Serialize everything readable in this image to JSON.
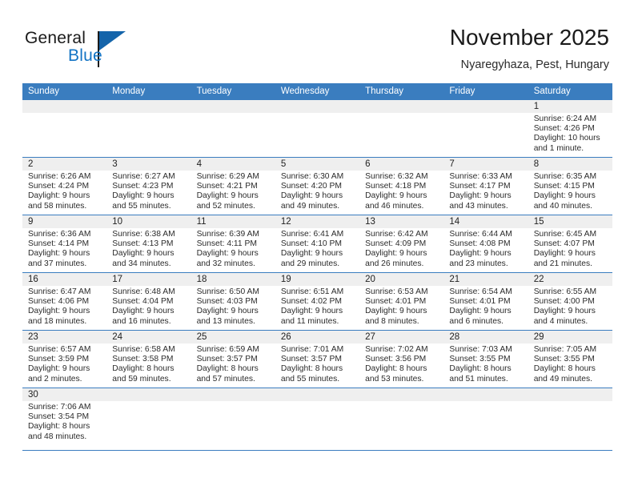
{
  "brand": {
    "word_one": "General",
    "word_two": "Blue",
    "logo_icon": "triangle-flag-icon",
    "accent_color": "#1273c4",
    "triangle_color": "#1464aa"
  },
  "header": {
    "title": "November 2025",
    "subtitle": "Nyaregyhaza, Pest, Hungary"
  },
  "theme": {
    "header_row_bg": "#3a7dbf",
    "day_band_bg": "#efefef",
    "row_separator": "#3a7dbf",
    "text": "#2b2b2b"
  },
  "calendar": {
    "weekday_headers": [
      "Sunday",
      "Monday",
      "Tuesday",
      "Wednesday",
      "Thursday",
      "Friday",
      "Saturday"
    ],
    "weeks": [
      [
        {
          "day": "",
          "lines": []
        },
        {
          "day": "",
          "lines": []
        },
        {
          "day": "",
          "lines": []
        },
        {
          "day": "",
          "lines": []
        },
        {
          "day": "",
          "lines": []
        },
        {
          "day": "",
          "lines": []
        },
        {
          "day": "1",
          "lines": [
            "Sunrise: 6:24 AM",
            "Sunset: 4:26 PM",
            "Daylight: 10 hours",
            "and 1 minute."
          ]
        }
      ],
      [
        {
          "day": "2",
          "lines": [
            "Sunrise: 6:26 AM",
            "Sunset: 4:24 PM",
            "Daylight: 9 hours",
            "and 58 minutes."
          ]
        },
        {
          "day": "3",
          "lines": [
            "Sunrise: 6:27 AM",
            "Sunset: 4:23 PM",
            "Daylight: 9 hours",
            "and 55 minutes."
          ]
        },
        {
          "day": "4",
          "lines": [
            "Sunrise: 6:29 AM",
            "Sunset: 4:21 PM",
            "Daylight: 9 hours",
            "and 52 minutes."
          ]
        },
        {
          "day": "5",
          "lines": [
            "Sunrise: 6:30 AM",
            "Sunset: 4:20 PM",
            "Daylight: 9 hours",
            "and 49 minutes."
          ]
        },
        {
          "day": "6",
          "lines": [
            "Sunrise: 6:32 AM",
            "Sunset: 4:18 PM",
            "Daylight: 9 hours",
            "and 46 minutes."
          ]
        },
        {
          "day": "7",
          "lines": [
            "Sunrise: 6:33 AM",
            "Sunset: 4:17 PM",
            "Daylight: 9 hours",
            "and 43 minutes."
          ]
        },
        {
          "day": "8",
          "lines": [
            "Sunrise: 6:35 AM",
            "Sunset: 4:15 PM",
            "Daylight: 9 hours",
            "and 40 minutes."
          ]
        }
      ],
      [
        {
          "day": "9",
          "lines": [
            "Sunrise: 6:36 AM",
            "Sunset: 4:14 PM",
            "Daylight: 9 hours",
            "and 37 minutes."
          ]
        },
        {
          "day": "10",
          "lines": [
            "Sunrise: 6:38 AM",
            "Sunset: 4:13 PM",
            "Daylight: 9 hours",
            "and 34 minutes."
          ]
        },
        {
          "day": "11",
          "lines": [
            "Sunrise: 6:39 AM",
            "Sunset: 4:11 PM",
            "Daylight: 9 hours",
            "and 32 minutes."
          ]
        },
        {
          "day": "12",
          "lines": [
            "Sunrise: 6:41 AM",
            "Sunset: 4:10 PM",
            "Daylight: 9 hours",
            "and 29 minutes."
          ]
        },
        {
          "day": "13",
          "lines": [
            "Sunrise: 6:42 AM",
            "Sunset: 4:09 PM",
            "Daylight: 9 hours",
            "and 26 minutes."
          ]
        },
        {
          "day": "14",
          "lines": [
            "Sunrise: 6:44 AM",
            "Sunset: 4:08 PM",
            "Daylight: 9 hours",
            "and 23 minutes."
          ]
        },
        {
          "day": "15",
          "lines": [
            "Sunrise: 6:45 AM",
            "Sunset: 4:07 PM",
            "Daylight: 9 hours",
            "and 21 minutes."
          ]
        }
      ],
      [
        {
          "day": "16",
          "lines": [
            "Sunrise: 6:47 AM",
            "Sunset: 4:06 PM",
            "Daylight: 9 hours",
            "and 18 minutes."
          ]
        },
        {
          "day": "17",
          "lines": [
            "Sunrise: 6:48 AM",
            "Sunset: 4:04 PM",
            "Daylight: 9 hours",
            "and 16 minutes."
          ]
        },
        {
          "day": "18",
          "lines": [
            "Sunrise: 6:50 AM",
            "Sunset: 4:03 PM",
            "Daylight: 9 hours",
            "and 13 minutes."
          ]
        },
        {
          "day": "19",
          "lines": [
            "Sunrise: 6:51 AM",
            "Sunset: 4:02 PM",
            "Daylight: 9 hours",
            "and 11 minutes."
          ]
        },
        {
          "day": "20",
          "lines": [
            "Sunrise: 6:53 AM",
            "Sunset: 4:01 PM",
            "Daylight: 9 hours",
            "and 8 minutes."
          ]
        },
        {
          "day": "21",
          "lines": [
            "Sunrise: 6:54 AM",
            "Sunset: 4:01 PM",
            "Daylight: 9 hours",
            "and 6 minutes."
          ]
        },
        {
          "day": "22",
          "lines": [
            "Sunrise: 6:55 AM",
            "Sunset: 4:00 PM",
            "Daylight: 9 hours",
            "and 4 minutes."
          ]
        }
      ],
      [
        {
          "day": "23",
          "lines": [
            "Sunrise: 6:57 AM",
            "Sunset: 3:59 PM",
            "Daylight: 9 hours",
            "and 2 minutes."
          ]
        },
        {
          "day": "24",
          "lines": [
            "Sunrise: 6:58 AM",
            "Sunset: 3:58 PM",
            "Daylight: 8 hours",
            "and 59 minutes."
          ]
        },
        {
          "day": "25",
          "lines": [
            "Sunrise: 6:59 AM",
            "Sunset: 3:57 PM",
            "Daylight: 8 hours",
            "and 57 minutes."
          ]
        },
        {
          "day": "26",
          "lines": [
            "Sunrise: 7:01 AM",
            "Sunset: 3:57 PM",
            "Daylight: 8 hours",
            "and 55 minutes."
          ]
        },
        {
          "day": "27",
          "lines": [
            "Sunrise: 7:02 AM",
            "Sunset: 3:56 PM",
            "Daylight: 8 hours",
            "and 53 minutes."
          ]
        },
        {
          "day": "28",
          "lines": [
            "Sunrise: 7:03 AM",
            "Sunset: 3:55 PM",
            "Daylight: 8 hours",
            "and 51 minutes."
          ]
        },
        {
          "day": "29",
          "lines": [
            "Sunrise: 7:05 AM",
            "Sunset: 3:55 PM",
            "Daylight: 8 hours",
            "and 49 minutes."
          ]
        }
      ],
      [
        {
          "day": "30",
          "lines": [
            "Sunrise: 7:06 AM",
            "Sunset: 3:54 PM",
            "Daylight: 8 hours",
            "and 48 minutes."
          ]
        },
        {
          "day": "",
          "lines": []
        },
        {
          "day": "",
          "lines": []
        },
        {
          "day": "",
          "lines": []
        },
        {
          "day": "",
          "lines": []
        },
        {
          "day": "",
          "lines": []
        },
        {
          "day": "",
          "lines": []
        }
      ]
    ]
  }
}
